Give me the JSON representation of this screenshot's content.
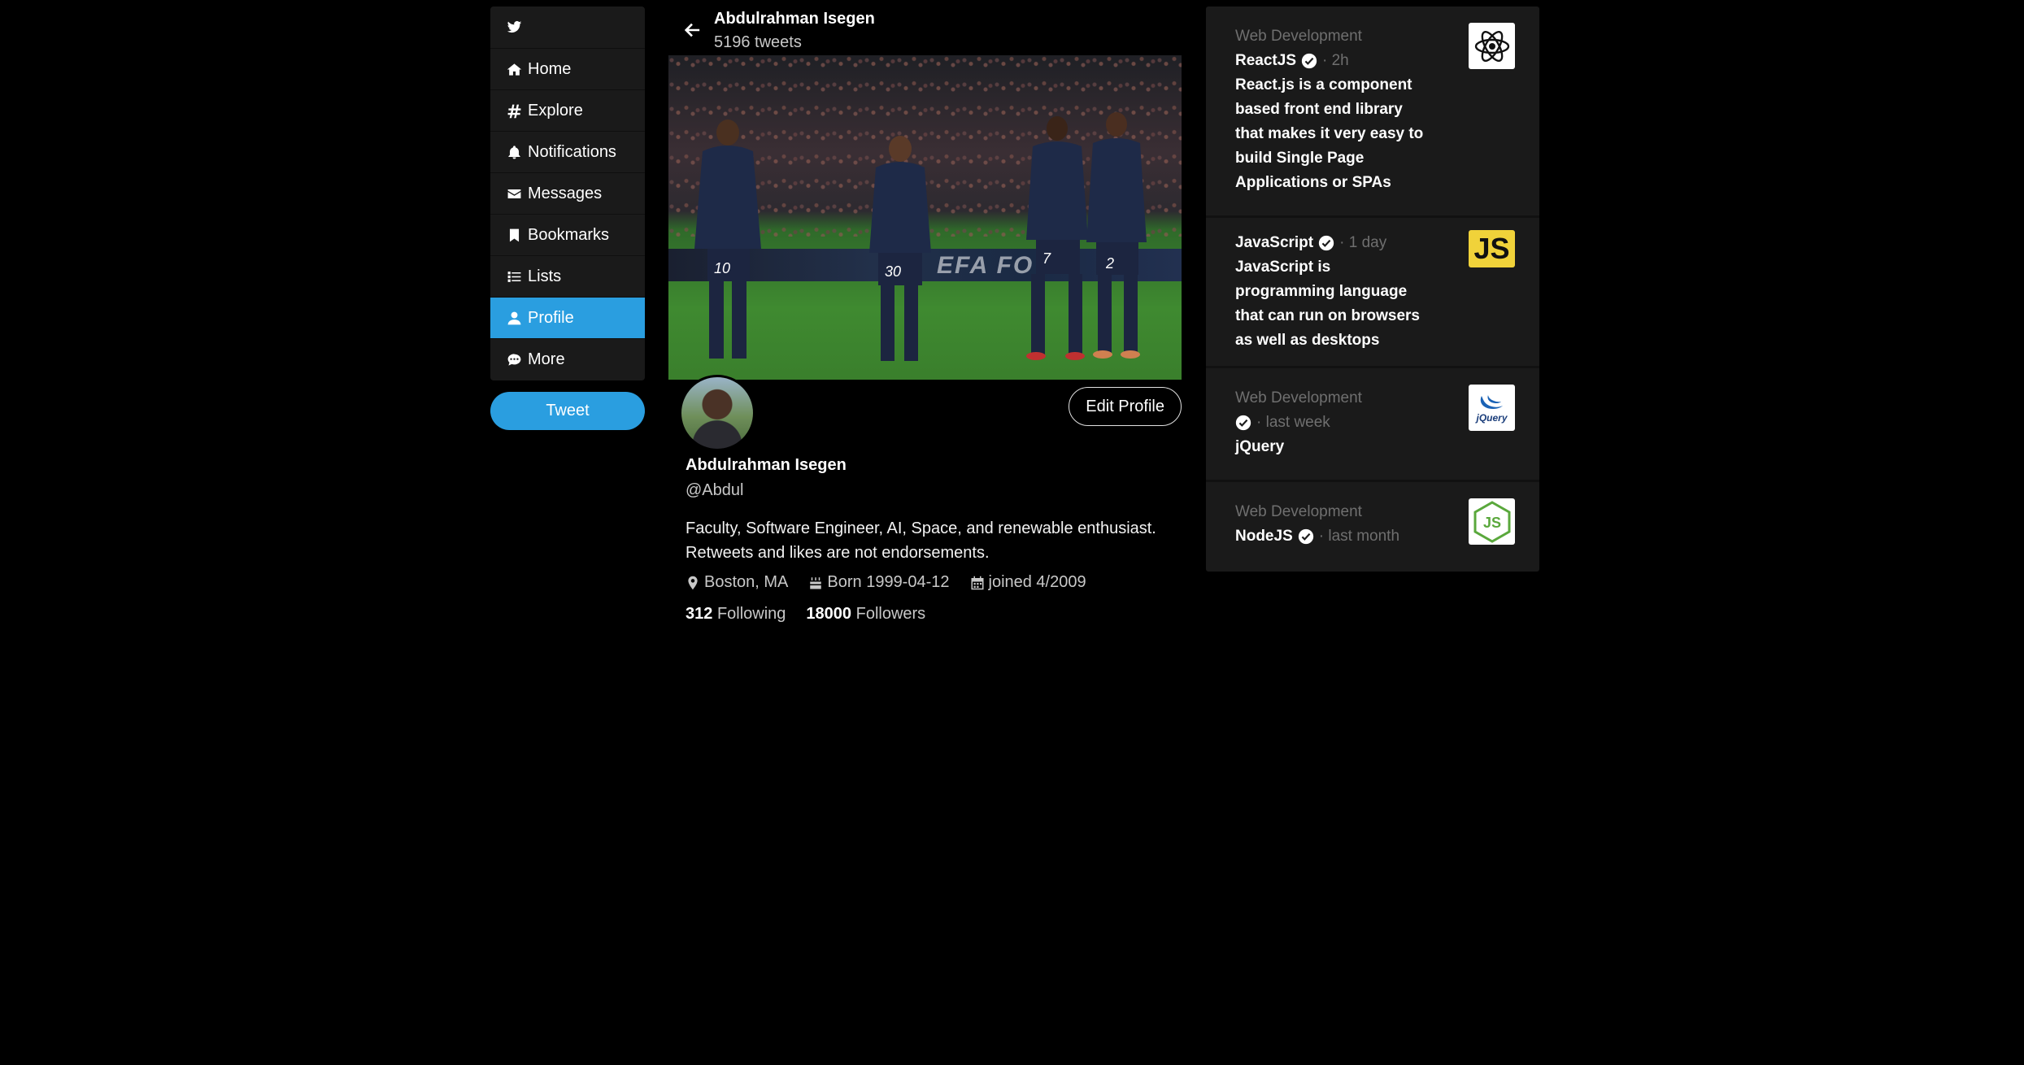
{
  "nav": {
    "items": [
      {
        "label": "Home"
      },
      {
        "label": "Explore"
      },
      {
        "label": "Notifications"
      },
      {
        "label": "Messages"
      },
      {
        "label": "Bookmarks"
      },
      {
        "label": "Lists"
      },
      {
        "label": "Profile"
      },
      {
        "label": "More"
      }
    ],
    "tweet_button": "Tweet",
    "active": "Profile",
    "accent_color": "#2a9ee0"
  },
  "header": {
    "name": "Abdulrahman Isegen",
    "tweet_count": "5196 tweets"
  },
  "cover": {
    "board_text": "EFA FO",
    "jersey_numbers": [
      "10",
      "30",
      "7",
      "2"
    ]
  },
  "profile": {
    "edit_button": "Edit Profile",
    "name": "Abdulrahman Isegen",
    "handle": "@Abdul",
    "bio": "Faculty, Software Engineer, AI, Space, and renewable enthusiast. Retweets and likes are not endorsements.",
    "location": "Boston, MA",
    "born": "Born 1999-04-12",
    "joined": "joined 4/2009",
    "following_count": "312",
    "following_label": "Following",
    "followers_count": "18000",
    "followers_label": "Followers"
  },
  "trends": [
    {
      "category": "Web Development",
      "title": "ReactJS",
      "time": "· 2h",
      "description": "React.js is a component based front end library that makes it very easy to build Single Page Applications or SPAs",
      "logo": "react-logo"
    },
    {
      "category": "",
      "title": "JavaScript",
      "time": "· 1 day",
      "description": "JavaScript is programming language that can run on browsers as well as desktops",
      "logo": "javascript-logo",
      "logo_text": "JS"
    },
    {
      "category": "Web Development",
      "title": "",
      "time": "· last week",
      "description": "jQuery",
      "logo": "jquery-logo",
      "logo_text": "jQuery"
    },
    {
      "category": "Web Development",
      "title": "NodeJS",
      "time": "· last month",
      "description": "",
      "logo": "nodejs-logo",
      "logo_text": "JS"
    }
  ]
}
